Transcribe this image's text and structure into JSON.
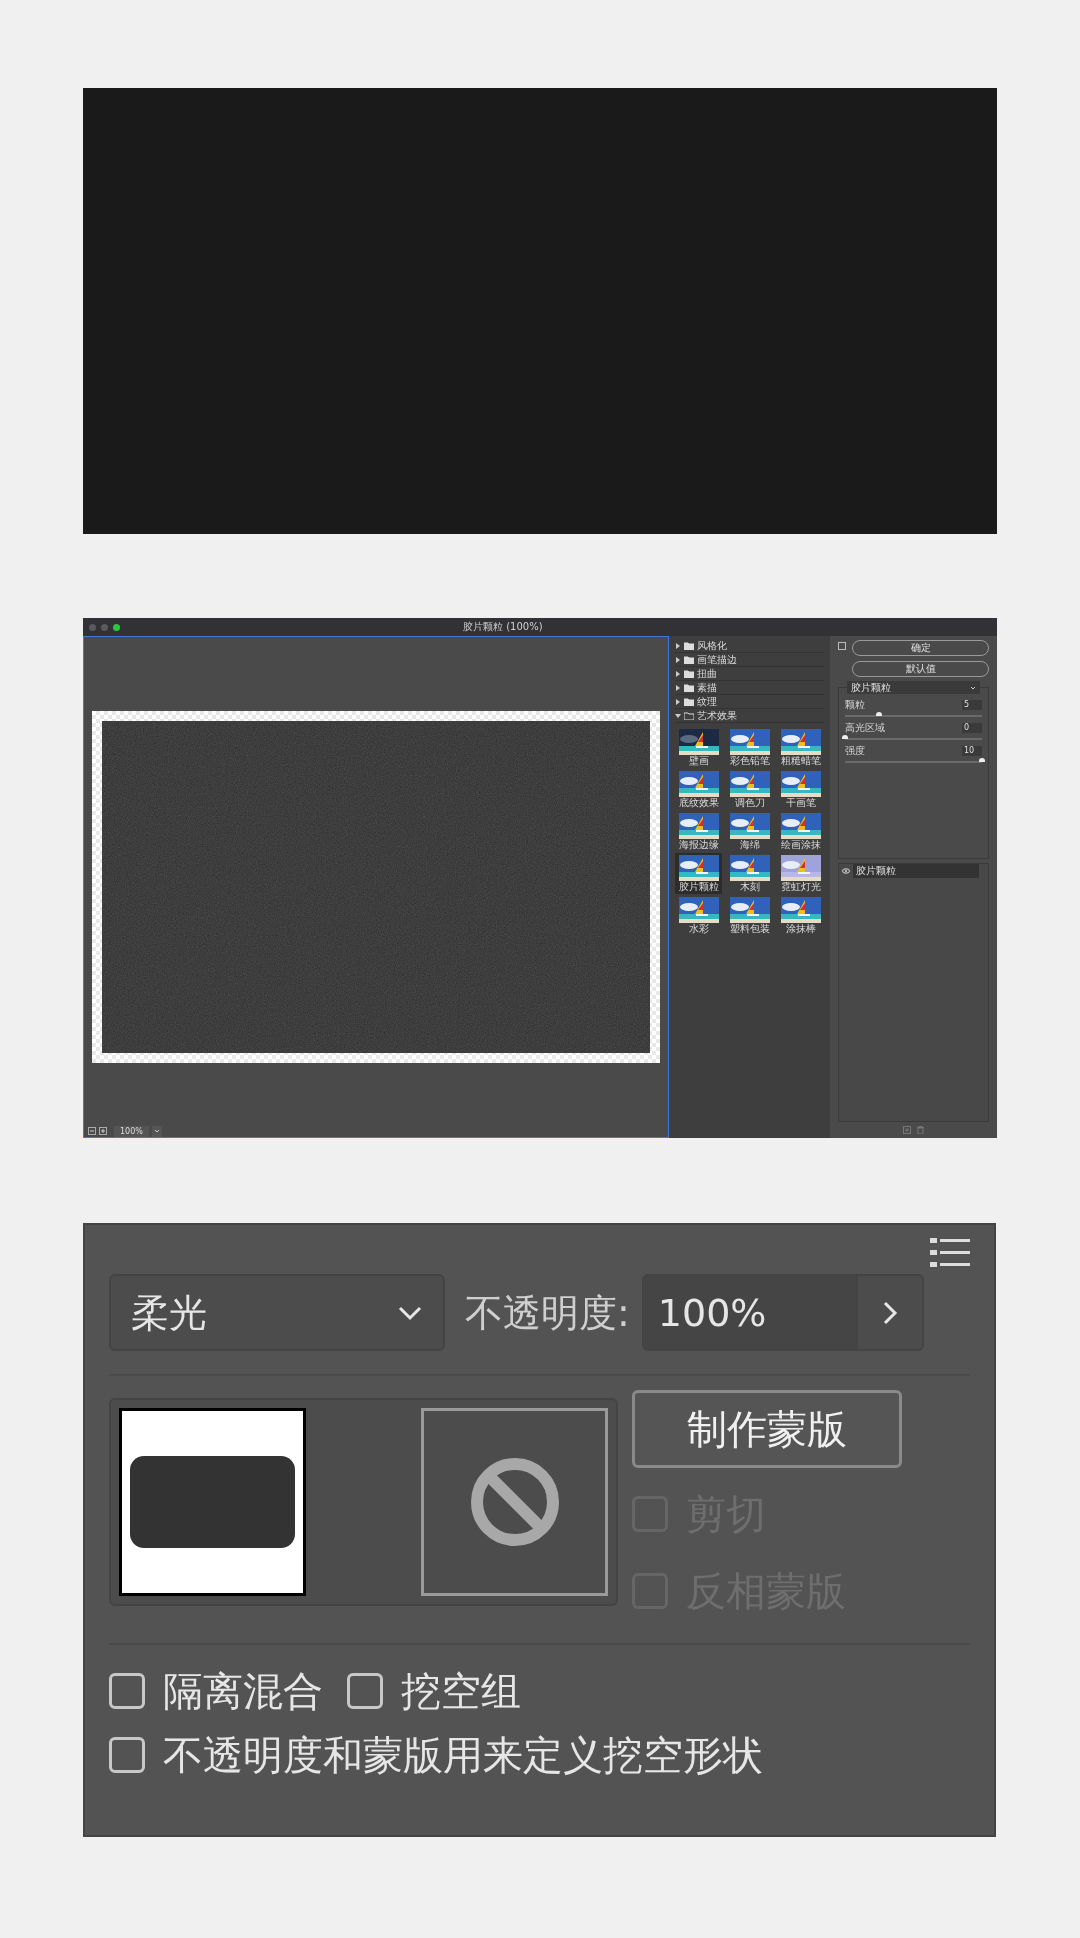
{
  "filter_gallery": {
    "title": "胶片颗粒 (100%)",
    "zoom": "100%",
    "categories": [
      {
        "label": "风格化",
        "expanded": false
      },
      {
        "label": "画笔描边",
        "expanded": false
      },
      {
        "label": "扭曲",
        "expanded": false
      },
      {
        "label": "素描",
        "expanded": false
      },
      {
        "label": "纹理",
        "expanded": false
      },
      {
        "label": "艺术效果",
        "expanded": true
      }
    ],
    "filters": [
      {
        "label": "壁画",
        "selected": false
      },
      {
        "label": "彩色铅笔",
        "selected": false
      },
      {
        "label": "粗糙蜡笔",
        "selected": false
      },
      {
        "label": "底纹效果",
        "selected": false
      },
      {
        "label": "调色刀",
        "selected": false
      },
      {
        "label": "干画笔",
        "selected": false
      },
      {
        "label": "海报边缘",
        "selected": false
      },
      {
        "label": "海绵",
        "selected": false
      },
      {
        "label": "绘画涂抹",
        "selected": false
      },
      {
        "label": "胶片颗粒",
        "selected": true
      },
      {
        "label": "木刻",
        "selected": false
      },
      {
        "label": "霓虹灯光",
        "selected": false
      },
      {
        "label": "水彩",
        "selected": false
      },
      {
        "label": "塑料包装",
        "selected": false
      },
      {
        "label": "涂抹棒",
        "selected": false
      }
    ],
    "buttons": [
      "确定",
      "默认值"
    ],
    "filter_select": "胶片颗粒",
    "settings": [
      {
        "label": "颗粒",
        "value": "5",
        "level": 0.25
      },
      {
        "label": "高光区域",
        "value": "0",
        "level": 0
      },
      {
        "label": "强度",
        "value": "10",
        "level": 1
      }
    ],
    "effect_layers": [
      {
        "label": "胶片颗粒",
        "visible": true
      }
    ]
  },
  "layer_panel": {
    "blend_mode": "柔光",
    "opacity_label": "不透明度:",
    "opacity": "100%",
    "mask_button": "制作蒙版",
    "mask_options": [
      {
        "label": "剪切",
        "checked": false,
        "disabled": true
      },
      {
        "label": "反相蒙版",
        "checked": false,
        "disabled": true
      }
    ],
    "blend_options": [
      {
        "label": "隔离混合",
        "checked": false
      },
      {
        "label": "挖空组",
        "checked": false
      }
    ],
    "shape_option": {
      "label": "不透明度和蒙版用来定义挖空形状",
      "checked": false
    }
  }
}
